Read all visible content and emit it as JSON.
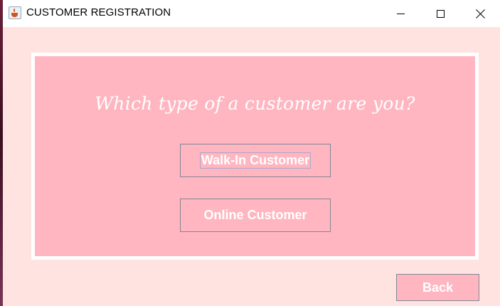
{
  "window": {
    "title": "CUSTOMER REGISTRATION",
    "icon": "java-cup-icon",
    "controls": [
      "minimize",
      "maximize",
      "close"
    ]
  },
  "panel": {
    "question": "Which type of a customer are you?",
    "buttons": {
      "walk_in": "Walk-In Customer",
      "online": "Online Customer"
    },
    "focused_button": "walk_in"
  },
  "footer": {
    "back_label": "Back"
  },
  "colors": {
    "background": "#ffe3e1",
    "panel": "#ffb6c1",
    "panel_border": "#ffffff",
    "button_border": "#7f8795",
    "text": "#ffffff"
  }
}
